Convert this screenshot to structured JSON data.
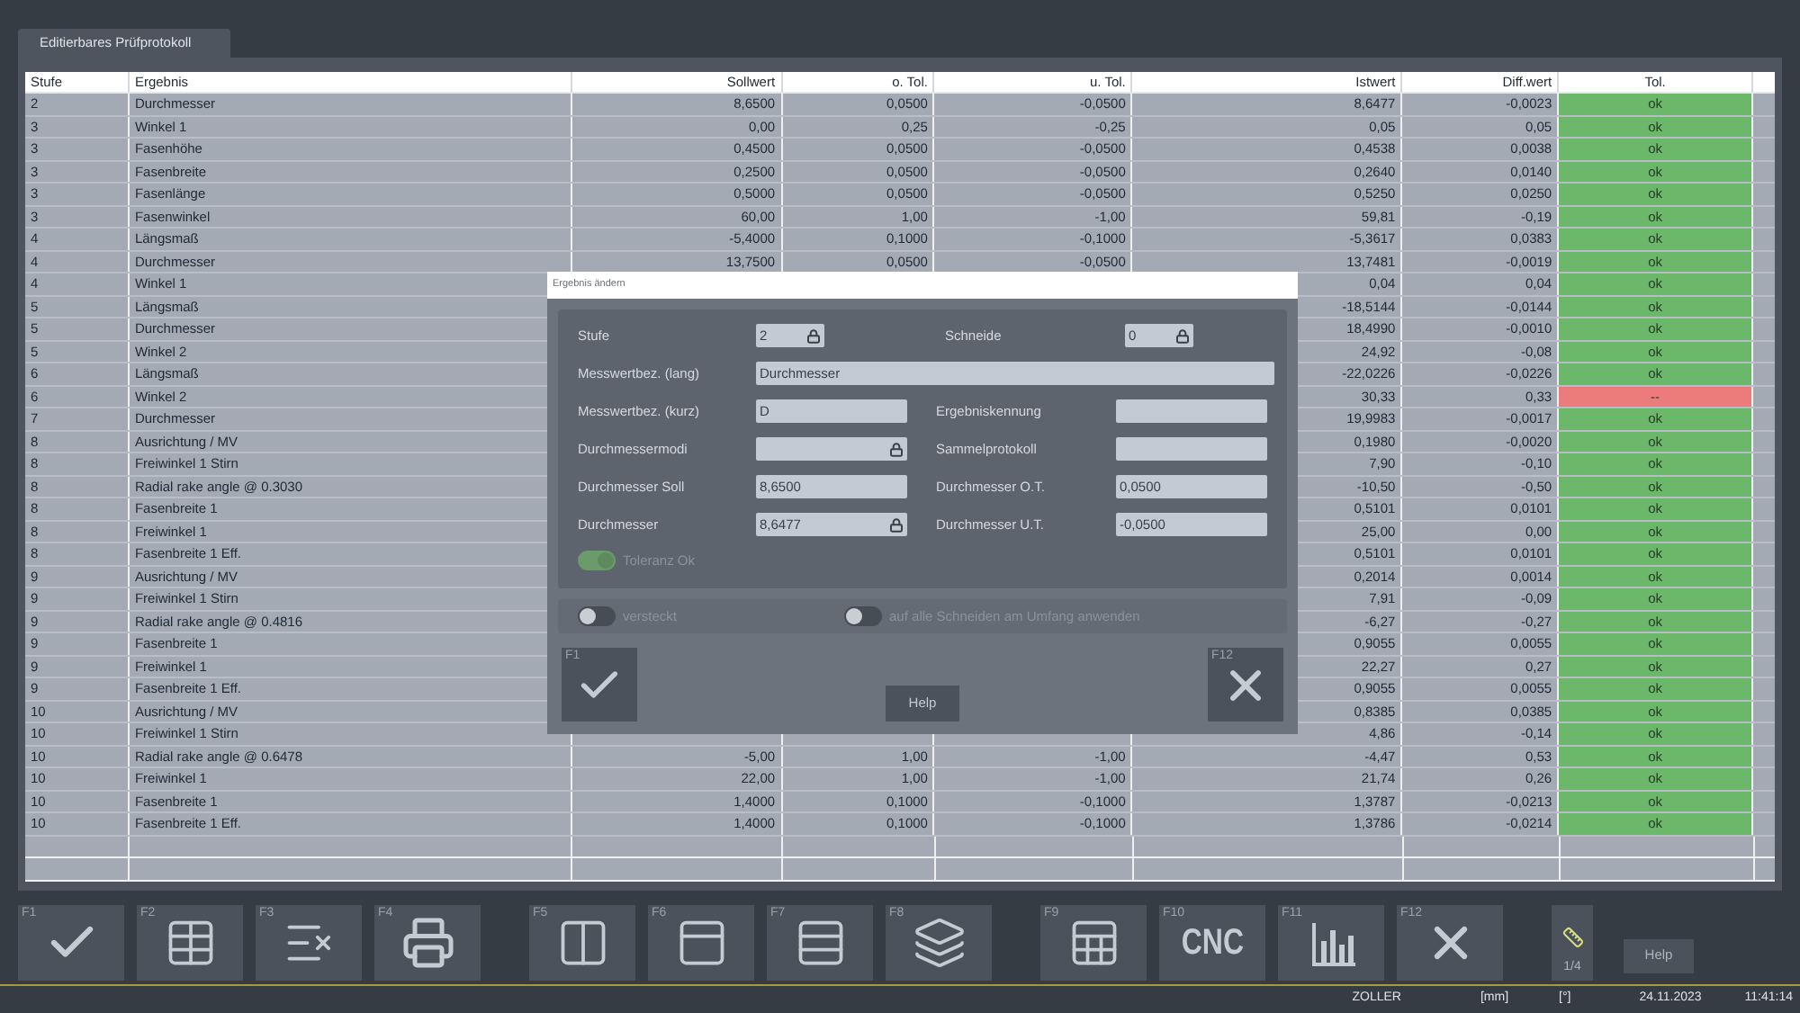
{
  "tab": {
    "label": "Editierbares Prüfprotokoll",
    "selected": true
  },
  "table": {
    "columns": [
      "Stufe",
      "Ergebnis",
      "Sollwert",
      "o. Tol.",
      "u. Tol.",
      "Istwert",
      "Diff.wert",
      "Tol."
    ],
    "rows": [
      {
        "stufe": "2",
        "ergebnis": "Durchmesser",
        "sollwert": "8,6500",
        "o_tol": "0,0500",
        "u_tol": "-0,0500",
        "istwert": "8,6477",
        "diff": "-0,0023",
        "tol": "ok",
        "in_tolerance": true
      },
      {
        "stufe": "3",
        "ergebnis": "Winkel 1",
        "sollwert": "0,00",
        "o_tol": "0,25",
        "u_tol": "-0,25",
        "istwert": "0,05",
        "diff": "0,05",
        "tol": "ok",
        "in_tolerance": true
      },
      {
        "stufe": "3",
        "ergebnis": "Fasenhöhe",
        "sollwert": "0,4500",
        "o_tol": "0,0500",
        "u_tol": "-0,0500",
        "istwert": "0,4538",
        "diff": "0,0038",
        "tol": "ok",
        "in_tolerance": true
      },
      {
        "stufe": "3",
        "ergebnis": "Fasenbreite",
        "sollwert": "0,2500",
        "o_tol": "0,0500",
        "u_tol": "-0,0500",
        "istwert": "0,2640",
        "diff": "0,0140",
        "tol": "ok",
        "in_tolerance": true
      },
      {
        "stufe": "3",
        "ergebnis": "Fasenlänge",
        "sollwert": "0,5000",
        "o_tol": "0,0500",
        "u_tol": "-0,0500",
        "istwert": "0,5250",
        "diff": "0,0250",
        "tol": "ok",
        "in_tolerance": true
      },
      {
        "stufe": "3",
        "ergebnis": "Fasenwinkel",
        "sollwert": "60,00",
        "o_tol": "1,00",
        "u_tol": "-1,00",
        "istwert": "59,81",
        "diff": "-0,19",
        "tol": "ok",
        "in_tolerance": true
      },
      {
        "stufe": "4",
        "ergebnis": "Längsmaß",
        "sollwert": "-5,4000",
        "o_tol": "0,1000",
        "u_tol": "-0,1000",
        "istwert": "-5,3617",
        "diff": "0,0383",
        "tol": "ok",
        "in_tolerance": true
      },
      {
        "stufe": "4",
        "ergebnis": "Durchmesser",
        "sollwert": "13,7500",
        "o_tol": "0,0500",
        "u_tol": "-0,0500",
        "istwert": "13,7481",
        "diff": "-0,0019",
        "tol": "ok",
        "in_tolerance": true
      },
      {
        "stufe": "4",
        "ergebnis": "Winkel 1",
        "istwert": "0,04",
        "diff": "0,04",
        "tol": "ok",
        "in_tolerance": true
      },
      {
        "stufe": "5",
        "ergebnis": "Längsmaß",
        "istwert": "-18,5144",
        "diff": "-0,0144",
        "tol": "ok",
        "in_tolerance": true
      },
      {
        "stufe": "5",
        "ergebnis": "Durchmesser",
        "istwert": "18,4990",
        "diff": "-0,0010",
        "tol": "ok",
        "in_tolerance": true
      },
      {
        "stufe": "5",
        "ergebnis": "Winkel 2",
        "istwert": "24,92",
        "diff": "-0,08",
        "tol": "ok",
        "in_tolerance": true
      },
      {
        "stufe": "6",
        "ergebnis": "Längsmaß",
        "istwert": "-22,0226",
        "diff": "-0,0226",
        "tol": "ok",
        "in_tolerance": true
      },
      {
        "stufe": "6",
        "ergebnis": "Winkel 2",
        "istwert": "30,33",
        "diff": "0,33",
        "tol": "--",
        "in_tolerance": false
      },
      {
        "stufe": "7",
        "ergebnis": "Durchmesser",
        "istwert": "19,9983",
        "diff": "-0,0017",
        "tol": "ok",
        "in_tolerance": true
      },
      {
        "stufe": "8",
        "ergebnis": "Ausrichtung / MV",
        "istwert": "0,1980",
        "diff": "-0,0020",
        "tol": "ok",
        "in_tolerance": true
      },
      {
        "stufe": "8",
        "ergebnis": "Freiwinkel 1 Stirn",
        "istwert": "7,90",
        "diff": "-0,10",
        "tol": "ok",
        "in_tolerance": true
      },
      {
        "stufe": "8",
        "ergebnis": "Radial rake angle @ 0.3030",
        "istwert": "-10,50",
        "diff": "-0,50",
        "tol": "ok",
        "in_tolerance": true
      },
      {
        "stufe": "8",
        "ergebnis": "Fasenbreite 1",
        "istwert": "0,5101",
        "diff": "0,0101",
        "tol": "ok",
        "in_tolerance": true
      },
      {
        "stufe": "8",
        "ergebnis": "Freiwinkel 1",
        "istwert": "25,00",
        "diff": "0,00",
        "tol": "ok",
        "in_tolerance": true
      },
      {
        "stufe": "8",
        "ergebnis": "Fasenbreite 1 Eff.",
        "istwert": "0,5101",
        "diff": "0,0101",
        "tol": "ok",
        "in_tolerance": true
      },
      {
        "stufe": "9",
        "ergebnis": "Ausrichtung / MV",
        "istwert": "0,2014",
        "diff": "0,0014",
        "tol": "ok",
        "in_tolerance": true
      },
      {
        "stufe": "9",
        "ergebnis": "Freiwinkel 1 Stirn",
        "istwert": "7,91",
        "diff": "-0,09",
        "tol": "ok",
        "in_tolerance": true
      },
      {
        "stufe": "9",
        "ergebnis": "Radial rake angle @ 0.4816",
        "istwert": "-6,27",
        "diff": "-0,27",
        "tol": "ok",
        "in_tolerance": true
      },
      {
        "stufe": "9",
        "ergebnis": "Fasenbreite 1",
        "istwert": "0,9055",
        "diff": "0,0055",
        "tol": "ok",
        "in_tolerance": true
      },
      {
        "stufe": "9",
        "ergebnis": "Freiwinkel 1",
        "istwert": "22,27",
        "diff": "0,27",
        "tol": "ok",
        "in_tolerance": true
      },
      {
        "stufe": "9",
        "ergebnis": "Fasenbreite 1 Eff.",
        "istwert": "0,9055",
        "diff": "0,0055",
        "tol": "ok",
        "in_tolerance": true
      },
      {
        "stufe": "10",
        "ergebnis": "Ausrichtung / MV",
        "istwert": "0,8385",
        "diff": "0,0385",
        "tol": "ok",
        "in_tolerance": true
      },
      {
        "stufe": "10",
        "ergebnis": "Freiwinkel 1 Stirn",
        "istwert": "4,86",
        "diff": "-0,14",
        "tol": "ok",
        "in_tolerance": true
      },
      {
        "stufe": "10",
        "ergebnis": "Radial rake angle @ 0.6478",
        "sollwert": "-5,00",
        "o_tol": "1,00",
        "u_tol": "-1,00",
        "istwert": "-4,47",
        "diff": "0,53",
        "tol": "ok",
        "in_tolerance": true
      },
      {
        "stufe": "10",
        "ergebnis": "Freiwinkel 1",
        "sollwert": "22,00",
        "o_tol": "1,00",
        "u_tol": "-1,00",
        "istwert": "21,74",
        "diff": "0,26",
        "tol": "ok",
        "in_tolerance": true
      },
      {
        "stufe": "10",
        "ergebnis": "Fasenbreite 1",
        "sollwert": "1,4000",
        "o_tol": "0,1000",
        "u_tol": "-0,1000",
        "istwert": "1,3787",
        "diff": "-0,0213",
        "tol": "ok",
        "in_tolerance": true
      },
      {
        "stufe": "10",
        "ergebnis": "Fasenbreite 1 Eff.",
        "sollwert": "1,4000",
        "o_tol": "0,1000",
        "u_tol": "-0,1000",
        "istwert": "1,3786",
        "diff": "-0,0214",
        "tol": "ok",
        "in_tolerance": true
      }
    ]
  },
  "dialog": {
    "title": "Ergebnis ändern",
    "field_rows": [
      [
        {
          "label": "Stufe",
          "value": "2",
          "locked": true,
          "kind": "short"
        },
        {
          "label": "Schneide",
          "value": "0",
          "locked": true,
          "kind": "short"
        }
      ],
      [
        {
          "label": "Messwertbez. (lang)",
          "value": "Durchmesser",
          "locked": false,
          "kind": "wide"
        }
      ],
      [
        {
          "label": "Messwertbez. (kurz)",
          "value": "D",
          "locked": false,
          "kind": "normal"
        },
        {
          "label": "Ergebniskennung",
          "locked": false,
          "kind": "normal"
        }
      ],
      [
        {
          "label": "Durchmessermodi",
          "locked": true,
          "kind": "normal"
        },
        {
          "label": "Sammelprotokoll",
          "locked": false,
          "kind": "normal"
        }
      ],
      [
        {
          "label": "Durchmesser Soll",
          "value": "8,6500",
          "locked": false,
          "kind": "normal"
        },
        {
          "label": "Durchmesser O.T.",
          "value": "0,0500",
          "locked": false,
          "kind": "normal"
        }
      ],
      [
        {
          "label": "Durchmesser",
          "value": "8,6477",
          "locked": true,
          "kind": "normal"
        },
        {
          "label": "Durchmesser U.T.",
          "value": "-0,0500",
          "locked": false,
          "kind": "normal"
        }
      ]
    ],
    "status_toggle": {
      "label": "Toleranz Ok",
      "on": true
    },
    "options": [
      {
        "label": "versteckt",
        "on": false
      },
      {
        "label": "auf alle Schneiden am Umfang anwenden",
        "on": false
      }
    ],
    "ok_key": "F1",
    "help": "Help",
    "cancel_key": "F12"
  },
  "toolbar": [
    {
      "key": "F1",
      "kind": "check"
    },
    {
      "key": "F2",
      "kind": "edit-table"
    },
    {
      "key": "F3",
      "kind": "delete-list"
    },
    {
      "key": "F4",
      "kind": "print"
    },
    {
      "key": "F5",
      "kind": "columns"
    },
    {
      "key": "F6",
      "kind": "dropdown"
    },
    {
      "key": "F7",
      "kind": "rows"
    },
    {
      "key": "F8",
      "kind": "layers"
    },
    {
      "key": "F9",
      "kind": "table-refresh"
    },
    {
      "key": "F10",
      "kind": "cnc",
      "text": "CNC"
    },
    {
      "key": "F11",
      "kind": "chart"
    },
    {
      "key": "F12",
      "kind": "close"
    }
  ],
  "pager": {
    "text": "1/4"
  },
  "help_button": "Help",
  "status_bar": [
    "ZOLLER",
    "[mm]",
    "[°]",
    "24.11.2023",
    "11:41:14"
  ]
}
